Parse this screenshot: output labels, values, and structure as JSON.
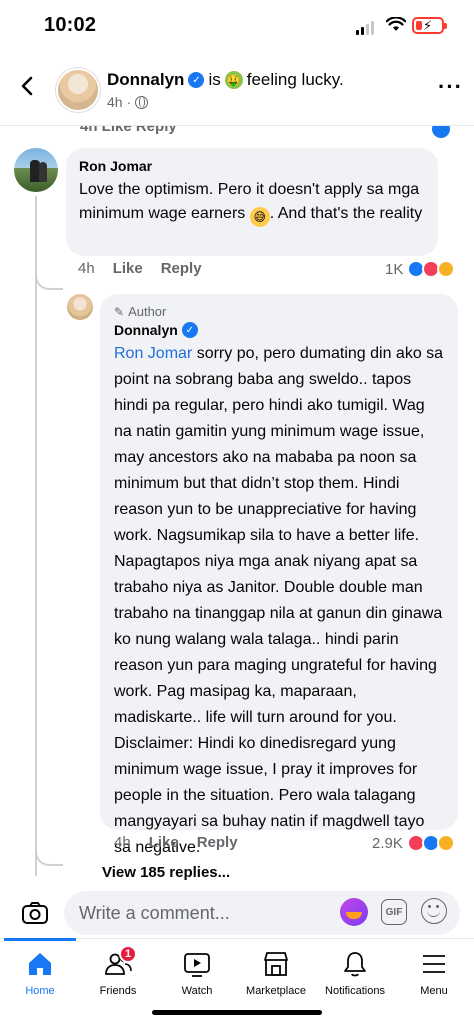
{
  "status_bar": {
    "time": "10:02"
  },
  "header": {
    "name": "Donnalyn",
    "feeling_prefix": "is",
    "feeling_text": "feeling lucky.",
    "time": "4h",
    "verified": true
  },
  "partial_actions": "4h   Like   Reply",
  "comment": {
    "author": "Ron Jomar",
    "text_before_emoji": "Love the optimism. Pero it doesn't apply sa mga minimum wage earners",
    "text_after_emoji": ". And that's the reality",
    "emoji": "sweat-smile-emoji",
    "time": "4h",
    "like_label": "Like",
    "reply_label": "Reply",
    "reaction_count": "1K"
  },
  "reply": {
    "badge": "Author",
    "author": "Donnalyn",
    "mention": "Ron Jomar",
    "text": " sorry po, pero dumating din ako sa point na sobrang baba ang sweldo.. tapos hindi pa regular, pero hindi ako tumigil. Wag na natin gamitin yung minimum wage issue, may ancestors ako na mababa pa noon sa minimum but that didn’t stop them. Hindi reason yun to be unappreciative for having work. Nagsumikap sila to have a better life. Napagtapos niya mga anak niyang apat sa trabaho niya as Janitor. Double double man trabaho na tinanggap nila at ganun din ginawa ko nung walang wala talaga.. hindi parin reason yun para maging ungrateful for having work. Pag masipag ka, maparaan, madiskarte.. life will turn around for you. Disclaimer: Hindi ko dinedisregard yung minimum wage issue, I pray it improves for people in the situation. Pero wala talagang mangyayari sa buhay natin if magdwell tayo sa negative.",
    "time": "4h",
    "like_label": "Like",
    "reply_label": "Reply",
    "reaction_count": "2.9K"
  },
  "view_replies": "View 185 replies...",
  "composer": {
    "placeholder": "Write a comment..."
  },
  "tabs": [
    {
      "label": "Home",
      "icon": "home-icon",
      "active": true
    },
    {
      "label": "Friends",
      "icon": "friends-icon",
      "badge": "1"
    },
    {
      "label": "Watch",
      "icon": "watch-icon"
    },
    {
      "label": "Marketplace",
      "icon": "marketplace-icon"
    },
    {
      "label": "Notifications",
      "icon": "bell-icon"
    },
    {
      "label": "Menu",
      "icon": "menu-icon"
    }
  ],
  "colors": {
    "accent": "#1877f2",
    "bubble": "#f0f2f5",
    "secondary_text": "#65676b",
    "badge": "#e41e3f"
  }
}
